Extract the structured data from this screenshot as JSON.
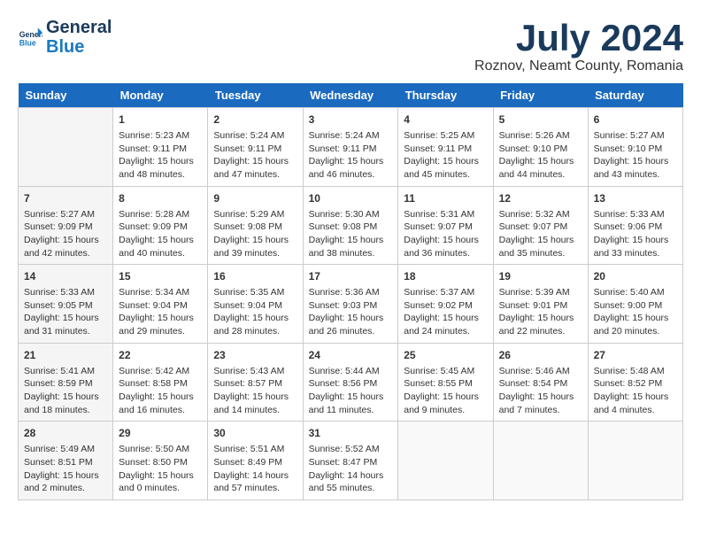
{
  "header": {
    "logo_line1": "General",
    "logo_line2": "Blue",
    "month": "July 2024",
    "location": "Roznov, Neamt County, Romania"
  },
  "days_of_week": [
    "Sunday",
    "Monday",
    "Tuesday",
    "Wednesday",
    "Thursday",
    "Friday",
    "Saturday"
  ],
  "weeks": [
    [
      {
        "day": "",
        "sunrise": "",
        "sunset": "",
        "daylight": ""
      },
      {
        "day": "1",
        "sunrise": "Sunrise: 5:23 AM",
        "sunset": "Sunset: 9:11 PM",
        "daylight": "Daylight: 15 hours and 48 minutes."
      },
      {
        "day": "2",
        "sunrise": "Sunrise: 5:24 AM",
        "sunset": "Sunset: 9:11 PM",
        "daylight": "Daylight: 15 hours and 47 minutes."
      },
      {
        "day": "3",
        "sunrise": "Sunrise: 5:24 AM",
        "sunset": "Sunset: 9:11 PM",
        "daylight": "Daylight: 15 hours and 46 minutes."
      },
      {
        "day": "4",
        "sunrise": "Sunrise: 5:25 AM",
        "sunset": "Sunset: 9:11 PM",
        "daylight": "Daylight: 15 hours and 45 minutes."
      },
      {
        "day": "5",
        "sunrise": "Sunrise: 5:26 AM",
        "sunset": "Sunset: 9:10 PM",
        "daylight": "Daylight: 15 hours and 44 minutes."
      },
      {
        "day": "6",
        "sunrise": "Sunrise: 5:27 AM",
        "sunset": "Sunset: 9:10 PM",
        "daylight": "Daylight: 15 hours and 43 minutes."
      }
    ],
    [
      {
        "day": "7",
        "sunrise": "Sunrise: 5:27 AM",
        "sunset": "Sunset: 9:09 PM",
        "daylight": "Daylight: 15 hours and 42 minutes."
      },
      {
        "day": "8",
        "sunrise": "Sunrise: 5:28 AM",
        "sunset": "Sunset: 9:09 PM",
        "daylight": "Daylight: 15 hours and 40 minutes."
      },
      {
        "day": "9",
        "sunrise": "Sunrise: 5:29 AM",
        "sunset": "Sunset: 9:08 PM",
        "daylight": "Daylight: 15 hours and 39 minutes."
      },
      {
        "day": "10",
        "sunrise": "Sunrise: 5:30 AM",
        "sunset": "Sunset: 9:08 PM",
        "daylight": "Daylight: 15 hours and 38 minutes."
      },
      {
        "day": "11",
        "sunrise": "Sunrise: 5:31 AM",
        "sunset": "Sunset: 9:07 PM",
        "daylight": "Daylight: 15 hours and 36 minutes."
      },
      {
        "day": "12",
        "sunrise": "Sunrise: 5:32 AM",
        "sunset": "Sunset: 9:07 PM",
        "daylight": "Daylight: 15 hours and 35 minutes."
      },
      {
        "day": "13",
        "sunrise": "Sunrise: 5:33 AM",
        "sunset": "Sunset: 9:06 PM",
        "daylight": "Daylight: 15 hours and 33 minutes."
      }
    ],
    [
      {
        "day": "14",
        "sunrise": "Sunrise: 5:33 AM",
        "sunset": "Sunset: 9:05 PM",
        "daylight": "Daylight: 15 hours and 31 minutes."
      },
      {
        "day": "15",
        "sunrise": "Sunrise: 5:34 AM",
        "sunset": "Sunset: 9:04 PM",
        "daylight": "Daylight: 15 hours and 29 minutes."
      },
      {
        "day": "16",
        "sunrise": "Sunrise: 5:35 AM",
        "sunset": "Sunset: 9:04 PM",
        "daylight": "Daylight: 15 hours and 28 minutes."
      },
      {
        "day": "17",
        "sunrise": "Sunrise: 5:36 AM",
        "sunset": "Sunset: 9:03 PM",
        "daylight": "Daylight: 15 hours and 26 minutes."
      },
      {
        "day": "18",
        "sunrise": "Sunrise: 5:37 AM",
        "sunset": "Sunset: 9:02 PM",
        "daylight": "Daylight: 15 hours and 24 minutes."
      },
      {
        "day": "19",
        "sunrise": "Sunrise: 5:39 AM",
        "sunset": "Sunset: 9:01 PM",
        "daylight": "Daylight: 15 hours and 22 minutes."
      },
      {
        "day": "20",
        "sunrise": "Sunrise: 5:40 AM",
        "sunset": "Sunset: 9:00 PM",
        "daylight": "Daylight: 15 hours and 20 minutes."
      }
    ],
    [
      {
        "day": "21",
        "sunrise": "Sunrise: 5:41 AM",
        "sunset": "Sunset: 8:59 PM",
        "daylight": "Daylight: 15 hours and 18 minutes."
      },
      {
        "day": "22",
        "sunrise": "Sunrise: 5:42 AM",
        "sunset": "Sunset: 8:58 PM",
        "daylight": "Daylight: 15 hours and 16 minutes."
      },
      {
        "day": "23",
        "sunrise": "Sunrise: 5:43 AM",
        "sunset": "Sunset: 8:57 PM",
        "daylight": "Daylight: 15 hours and 14 minutes."
      },
      {
        "day": "24",
        "sunrise": "Sunrise: 5:44 AM",
        "sunset": "Sunset: 8:56 PM",
        "daylight": "Daylight: 15 hours and 11 minutes."
      },
      {
        "day": "25",
        "sunrise": "Sunrise: 5:45 AM",
        "sunset": "Sunset: 8:55 PM",
        "daylight": "Daylight: 15 hours and 9 minutes."
      },
      {
        "day": "26",
        "sunrise": "Sunrise: 5:46 AM",
        "sunset": "Sunset: 8:54 PM",
        "daylight": "Daylight: 15 hours and 7 minutes."
      },
      {
        "day": "27",
        "sunrise": "Sunrise: 5:48 AM",
        "sunset": "Sunset: 8:52 PM",
        "daylight": "Daylight: 15 hours and 4 minutes."
      }
    ],
    [
      {
        "day": "28",
        "sunrise": "Sunrise: 5:49 AM",
        "sunset": "Sunset: 8:51 PM",
        "daylight": "Daylight: 15 hours and 2 minutes."
      },
      {
        "day": "29",
        "sunrise": "Sunrise: 5:50 AM",
        "sunset": "Sunset: 8:50 PM",
        "daylight": "Daylight: 15 hours and 0 minutes."
      },
      {
        "day": "30",
        "sunrise": "Sunrise: 5:51 AM",
        "sunset": "Sunset: 8:49 PM",
        "daylight": "Daylight: 14 hours and 57 minutes."
      },
      {
        "day": "31",
        "sunrise": "Sunrise: 5:52 AM",
        "sunset": "Sunset: 8:47 PM",
        "daylight": "Daylight: 14 hours and 55 minutes."
      },
      {
        "day": "",
        "sunrise": "",
        "sunset": "",
        "daylight": ""
      },
      {
        "day": "",
        "sunrise": "",
        "sunset": "",
        "daylight": ""
      },
      {
        "day": "",
        "sunrise": "",
        "sunset": "",
        "daylight": ""
      }
    ]
  ]
}
